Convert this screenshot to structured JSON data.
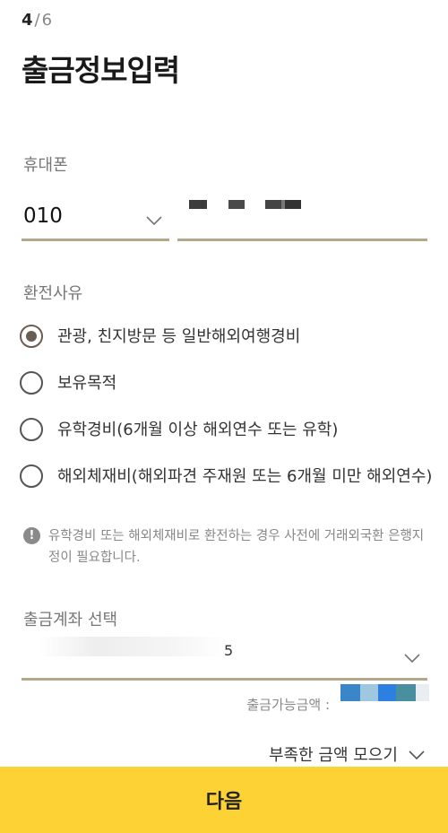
{
  "header": {
    "step_current": "4",
    "step_separator": "/",
    "step_total": "6",
    "title": "출금정보입력"
  },
  "phone": {
    "label": "휴대폰",
    "prefix": "010"
  },
  "reason": {
    "label": "환전사유",
    "options": [
      {
        "label": "관광, 친지방문 등 일반해외여행경비",
        "selected": true
      },
      {
        "label": "보유목적",
        "selected": false
      },
      {
        "label": "유학경비(6개월 이상 해외연수 또는 유학)",
        "selected": false
      },
      {
        "label": "해외체재비(해외파견 주재원 또는 6개월 미만 해외연수)",
        "selected": false
      }
    ],
    "notice": "유학경비 또는 해외체재비로 환전하는 경우 사전에 거래외국환 은행지정이 필요합니다."
  },
  "account": {
    "label": "출금계좌 선택",
    "value_tail": "5"
  },
  "available_amount_label": "출금가능금액 :",
  "collect_shortfall": "부족한 금액 모으기",
  "next_button": "다음",
  "colors": {
    "accent_underline": "#b5a78a",
    "radio_selected": "#6b5d52",
    "button_bg": "#fdd235",
    "amount_mask": [
      "#3a86c8",
      "#9fc8e0",
      "#2d7fe0",
      "#4a8fa0",
      "#e8eef2"
    ]
  },
  "icons": {
    "info": "info-icon",
    "chevron": "chevron-down-icon"
  }
}
